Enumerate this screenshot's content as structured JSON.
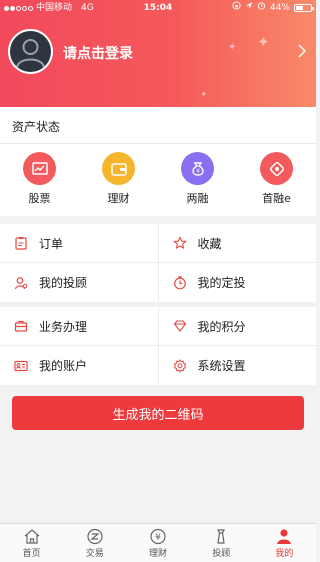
{
  "status_bar": {
    "carrier": "中国移动",
    "network": "4G",
    "time": "15:04",
    "battery": "44%"
  },
  "header": {
    "login_prompt": "请点击登录"
  },
  "assets": {
    "title": "资产状态",
    "items": [
      {
        "label": "股票",
        "icon": "stock-chart-icon",
        "color": "#f25a5e"
      },
      {
        "label": "理财",
        "icon": "wallet-icon",
        "color": "#f5b52d"
      },
      {
        "label": "两融",
        "icon": "money-bag-icon",
        "color": "#8a6ff0"
      },
      {
        "label": "首融e",
        "icon": "diamond-tag-icon",
        "color": "#f25a5e"
      }
    ]
  },
  "menu": {
    "orders": "订单",
    "favorites": "收藏",
    "my_advisor": "我的投顾",
    "my_fixed_invest": "我的定投",
    "business": "业务办理",
    "my_points": "我的积分",
    "my_account": "我的账户",
    "settings": "系统设置"
  },
  "qr_button": "生成我的二维码",
  "tabs": [
    {
      "label": "首页",
      "icon": "home-icon"
    },
    {
      "label": "交易",
      "icon": "trade-icon"
    },
    {
      "label": "理财",
      "icon": "yuan-icon"
    },
    {
      "label": "投顾",
      "icon": "advisor-icon"
    },
    {
      "label": "我的",
      "icon": "person-icon",
      "active": true
    }
  ],
  "colors": {
    "accent": "#ee3a3d",
    "header_start": "#f2495c",
    "header_end": "#f98a6a"
  }
}
